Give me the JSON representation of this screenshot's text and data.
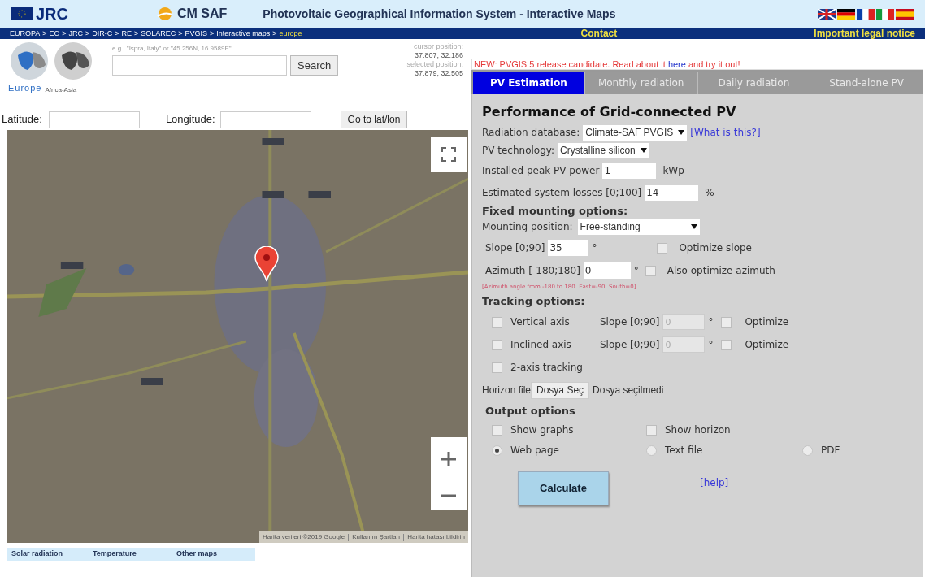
{
  "header": {
    "jrc_logo": "JRC",
    "cmsaf_logo": "CM SAF",
    "title": "Photovoltaic Geographical Information System - Interactive Maps"
  },
  "breadcrumb": {
    "separator": ">",
    "items": [
      {
        "label": "EUROPA",
        "current": false
      },
      {
        "label": "EC",
        "current": false
      },
      {
        "label": "JRC",
        "current": false
      },
      {
        "label": "DIR-C",
        "current": false
      },
      {
        "label": "RE",
        "current": false
      },
      {
        "label": "SOLAREC",
        "current": false
      },
      {
        "label": "PVGIS",
        "current": false
      },
      {
        "label": "Interactive maps",
        "current": false
      },
      {
        "label": "europe",
        "current": true
      }
    ],
    "contact": "Contact",
    "legal": "Important legal notice"
  },
  "regions": [
    {
      "label": "Europe",
      "selected": true
    },
    {
      "label": "Africa-Asia",
      "selected": false
    }
  ],
  "search": {
    "hint": "e.g., \"Ispra, Italy\" or \"45.256N, 16.9589E\"",
    "button": "Search"
  },
  "position": {
    "cursor_label": "cursor position:",
    "cursor": "37.807, 32.186",
    "selected_label": "selected position:",
    "selected": "37.879, 32.505"
  },
  "latlon": {
    "latitude": "Latitude:",
    "longitude": "Longitude:",
    "button": "Go to lat/lon"
  },
  "map": {
    "attribution": [
      "Harita verileri ©2019 Google",
      "Kullanım Şartları",
      "Harita hatası bildirin"
    ]
  },
  "map_tabs": [
    "Solar radiation",
    "Temperature",
    "Other maps"
  ],
  "notice": {
    "before": "NEW: PVGIS 5 release candidate. Read about it ",
    "link": "here",
    "after": " and try it out!"
  },
  "tabs": [
    {
      "label": "PV Estimation",
      "selected": true
    },
    {
      "label": "Monthly radiation",
      "selected": false
    },
    {
      "label": "Daily radiation",
      "selected": false
    },
    {
      "label": "Stand-alone PV",
      "selected": false
    }
  ],
  "form": {
    "title": "Performance of Grid-connected PV",
    "database": {
      "label": "Radiation database:",
      "value": "Climate-SAF PVGIS",
      "link": "[What is this?]"
    },
    "technology": {
      "label": "PV technology:",
      "value": "Crystalline silicon"
    },
    "power": {
      "label": "Installed peak PV power",
      "value": "1",
      "unit": "kWp"
    },
    "losses": {
      "label": "Estimated system losses [0;100]",
      "value": "14",
      "unit": "%"
    },
    "fixed_heading": "Fixed mounting options:",
    "mounting": {
      "label": "Mounting position:",
      "value": "Free-standing"
    },
    "slope": {
      "label": "Slope [0;90]",
      "value": "35",
      "unit": "°",
      "option": "Optimize slope",
      "checked": false
    },
    "azimuth": {
      "label": "Azimuth [-180;180]",
      "value": "0",
      "unit": "°",
      "option": "Also optimize azimuth",
      "checked": false
    },
    "azimuth_note": "[Azimuth angle from -180 to 180. East=-90, South=0]",
    "tracking_heading": "Tracking options:",
    "tracking": [
      {
        "label": "Vertical axis",
        "checked": false,
        "slope_label": "Slope [0;90]",
        "value": "0",
        "unit": "°",
        "option": "Optimize",
        "option_checked": false,
        "disabled": true
      },
      {
        "label": "Inclined axis",
        "checked": false,
        "slope_label": "Slope [0;90]",
        "value": "0",
        "unit": "°",
        "option": "Optimize",
        "option_checked": false,
        "disabled": true
      },
      {
        "label": "2-axis tracking",
        "checked": false
      }
    ],
    "horizon": {
      "label": "Horizon file",
      "button": "Dosya Seç",
      "status": "Dosya seçilmedi"
    },
    "output_heading": "Output options",
    "output_checks": [
      {
        "label": "Show graphs",
        "checked": false
      },
      {
        "label": "Show horizon",
        "checked": false
      }
    ],
    "output_formats": [
      {
        "label": "Web page",
        "selected": true
      },
      {
        "label": "Text file",
        "selected": false
      },
      {
        "label": "PDF",
        "selected": false
      }
    ],
    "calculate": "Calculate",
    "help": "[help]"
  }
}
